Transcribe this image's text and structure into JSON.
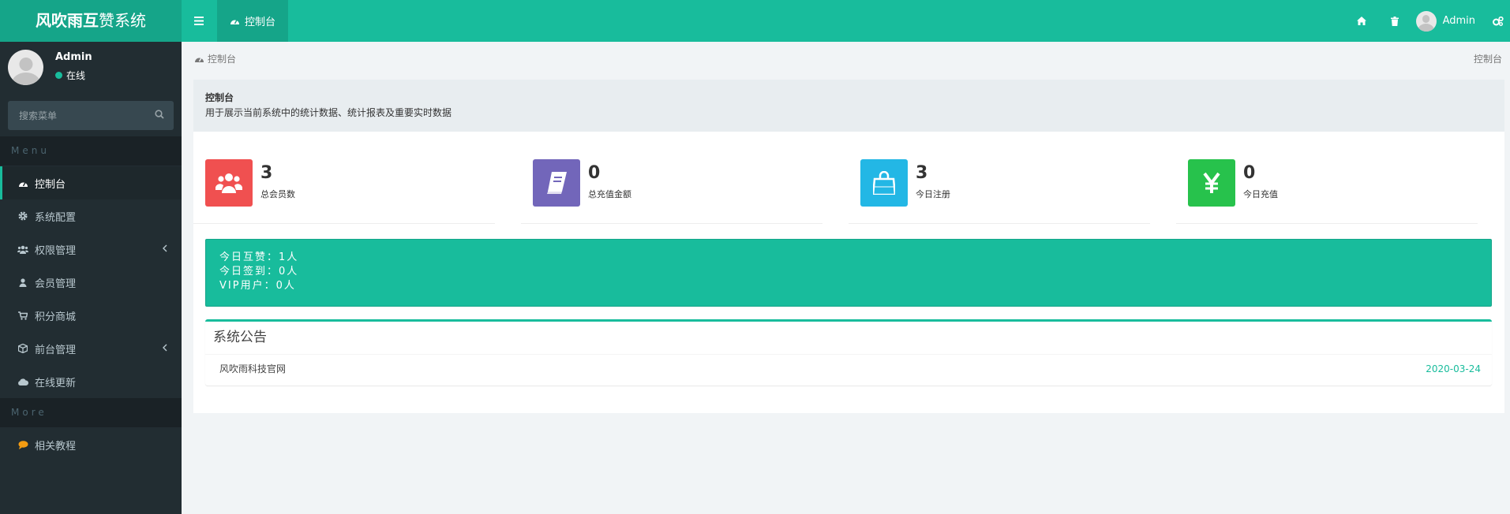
{
  "header": {
    "logo_bold": "风吹雨互",
    "logo_rest": "赞系统",
    "tab_label": "控制台",
    "user_name": "Admin"
  },
  "sidebar": {
    "user_name": "Admin",
    "user_status": "在线",
    "search_placeholder": "搜索菜单",
    "menu_header": "Menu",
    "more_header": "More",
    "items": [
      {
        "label": "控制台",
        "icon": "dashboard-icon"
      },
      {
        "label": "系统配置",
        "icon": "gear-icon"
      },
      {
        "label": "权限管理",
        "icon": "users-icon"
      },
      {
        "label": "会员管理",
        "icon": "user-icon"
      },
      {
        "label": "积分商城",
        "icon": "cart-icon"
      },
      {
        "label": "前台管理",
        "icon": "cube-icon"
      },
      {
        "label": "在线更新",
        "icon": "cloud-icon"
      }
    ],
    "more_items": [
      {
        "label": "相关教程",
        "icon": "comment-icon"
      }
    ]
  },
  "breadcrumb": {
    "left": "控制台",
    "right": "控制台"
  },
  "panel": {
    "title": "控制台",
    "description": "用于展示当前系统中的统计数据、统计报表及重要实时数据"
  },
  "stats": [
    {
      "value": "3",
      "label": "总会员数",
      "color": "#f05050",
      "icon": "users-icon"
    },
    {
      "value": "0",
      "label": "总充值金额",
      "color": "#7266ba",
      "icon": "book-icon"
    },
    {
      "value": "3",
      "label": "今日注册",
      "color": "#23b7e5",
      "icon": "shopping-bag-icon"
    },
    {
      "value": "0",
      "label": "今日充值",
      "color": "#27c24c",
      "icon": "yen-icon"
    }
  ],
  "notice": {
    "line1": "今日互赞：1人",
    "line2": "今日签到：0人",
    "line3": "VIP用户：0人"
  },
  "announcement": {
    "title": "系统公告",
    "rows": [
      {
        "text": "风吹雨科技官网",
        "date": "2020-03-24"
      }
    ]
  },
  "colors": {
    "accent": "#18bc9c",
    "accent_dark": "#15a589",
    "sidebar_bg": "#222d32"
  }
}
